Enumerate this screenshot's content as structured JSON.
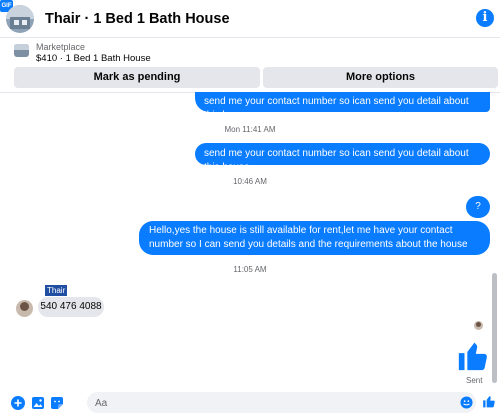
{
  "header": {
    "title": "Thair · 1 Bed 1 Bath House",
    "info_icon": "info-icon",
    "info_glyph": "i"
  },
  "marketplace": {
    "label": "Marketplace",
    "listing": "$410 · 1 Bed 1 Bath House"
  },
  "actions": {
    "pending_label": "Mark as pending",
    "more_label": "More options"
  },
  "messages": [
    {
      "direction": "out",
      "text": "send me your contact number so ican send you detail about this house."
    },
    {
      "timestamp": "Mon 11:41 AM"
    },
    {
      "direction": "out",
      "text": "send me your contact number so ican send you detail about this house."
    },
    {
      "timestamp": "10:46 AM"
    },
    {
      "direction": "out",
      "text": "?"
    },
    {
      "direction": "out",
      "text": "Hello,yes the house is still available for rent,let me have your contact number so I can send you details and the requirements about the house"
    },
    {
      "timestamp": "11:05 AM"
    },
    {
      "direction": "in",
      "sender": "Thair",
      "text": "540 476 4088"
    }
  ],
  "status": {
    "sent_label": "Sent"
  },
  "composer": {
    "placeholder": "Aa",
    "gif_label": "GIF"
  },
  "colors": {
    "accent": "#0a7cff",
    "bubble_in": "#e4e6eb",
    "secondary_text": "#65676b"
  }
}
